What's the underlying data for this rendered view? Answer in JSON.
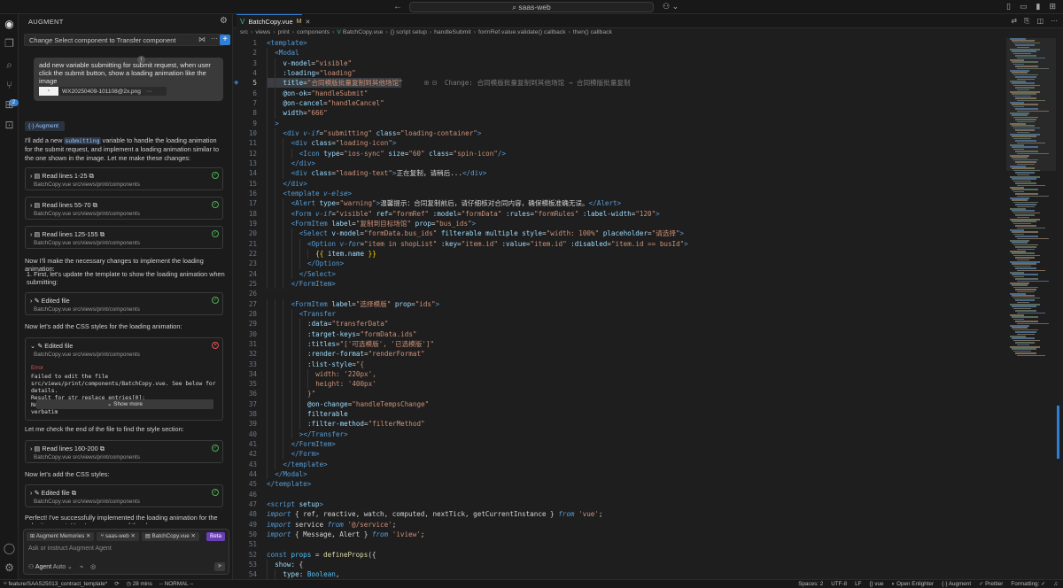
{
  "titlebar": {
    "back": "←",
    "forward": "→",
    "search": "saas-web",
    "copilot": "⚇ ⌄",
    "layout_icons": [
      "▯",
      "▭",
      "▮",
      "⊞"
    ]
  },
  "activity": {
    "badge": "2"
  },
  "sidepanel": {
    "title": "AUGMENT",
    "thread_title": "Change Select component to Transfer component",
    "user_message": "add new variable submitting for submit request, when user click the submit button, show a loading animation like the image",
    "attachment_name": "WX20250409-101108@2x.png",
    "attachment_more": "···",
    "augment_label": "Augment",
    "intro_pre": "I'll add a new ",
    "intro_code": "submitting",
    "intro_post": " variable to handle the loading animation for the submit request, and implement a loading animation similar to the one shown in the image. Let me make these changes:",
    "tools": [
      {
        "title": "Read lines 1-25",
        "path": "BatchCopy.vue  src/views/print/components"
      },
      {
        "title": "Read lines 55-70",
        "path": "BatchCopy.vue  src/views/print/components"
      },
      {
        "title": "Read lines 125-155",
        "path": "BatchCopy.vue  src/views/print/components"
      }
    ],
    "now_changes": "Now I'll make the necessary changes to implement the loading animation:",
    "step1": "1. First, let's update the template to show the loading animation when submitting:",
    "edited_file_1": {
      "title": "Edited file",
      "path": "BatchCopy.vue  src/views/print/components"
    },
    "css_styles": "Now let's add the CSS styles for the loading animation:",
    "edited_file_err": {
      "title": "Edited file",
      "path": "BatchCopy.vue  src/views/print/components"
    },
    "error_label": "Error",
    "error_text": "Failed to edit the file src/views/print/components/BatchCopy.vue. See below for details.\nResult for str_replace_entries[0]:\nNo replacement was performed, oldStr did not appear verbatim",
    "show_more": "⌄ Show more",
    "check_end": "Let me check the end of the file to find the style section:",
    "read_160": {
      "title": "Read lines 160-200",
      "path": "BatchCopy.vue  src/views/print/components"
    },
    "add_css": "Now let's add the CSS styles:",
    "edited_file_2": {
      "title": "Edited file",
      "path": "BatchCopy.vue  src/views/print/components"
    },
    "perfect": "Perfect! I've successfully implemented the loading animation for the submit request. Here's a summary of the changes:",
    "chips": [
      "Augment Memories",
      "saas-web",
      "BatchCopy.vue"
    ],
    "beta": "Beta",
    "input_placeholder": "Ask or instruct Augment Agent",
    "agent_label": "Agent",
    "agent_mode": "Auto"
  },
  "editor": {
    "tab_label": "BatchCopy.vue",
    "tab_mod": "M",
    "breadcrumb": [
      "src",
      "views",
      "print",
      "components",
      "BatchCopy.vue",
      "{} script setup",
      "handleSubmit",
      "formRef.value.validate() callback",
      "then() callback"
    ],
    "ghost_change": "Change: 合同模版批量复制到其他场馆 → 合同模版批量复制",
    "start_line": 1
  },
  "statusbar": {
    "branch": "feature/SAAS25013_contract_template*",
    "time": "28 mins",
    "mode": "-- NORMAL --",
    "spaces": "Spaces: 2",
    "encoding": "UTF-8",
    "eol": "LF",
    "language": "vue",
    "enlighter": "Open Enlighter",
    "augment": "Augment",
    "prettier": "Prettier",
    "formatting": "Formatting: ✓"
  }
}
